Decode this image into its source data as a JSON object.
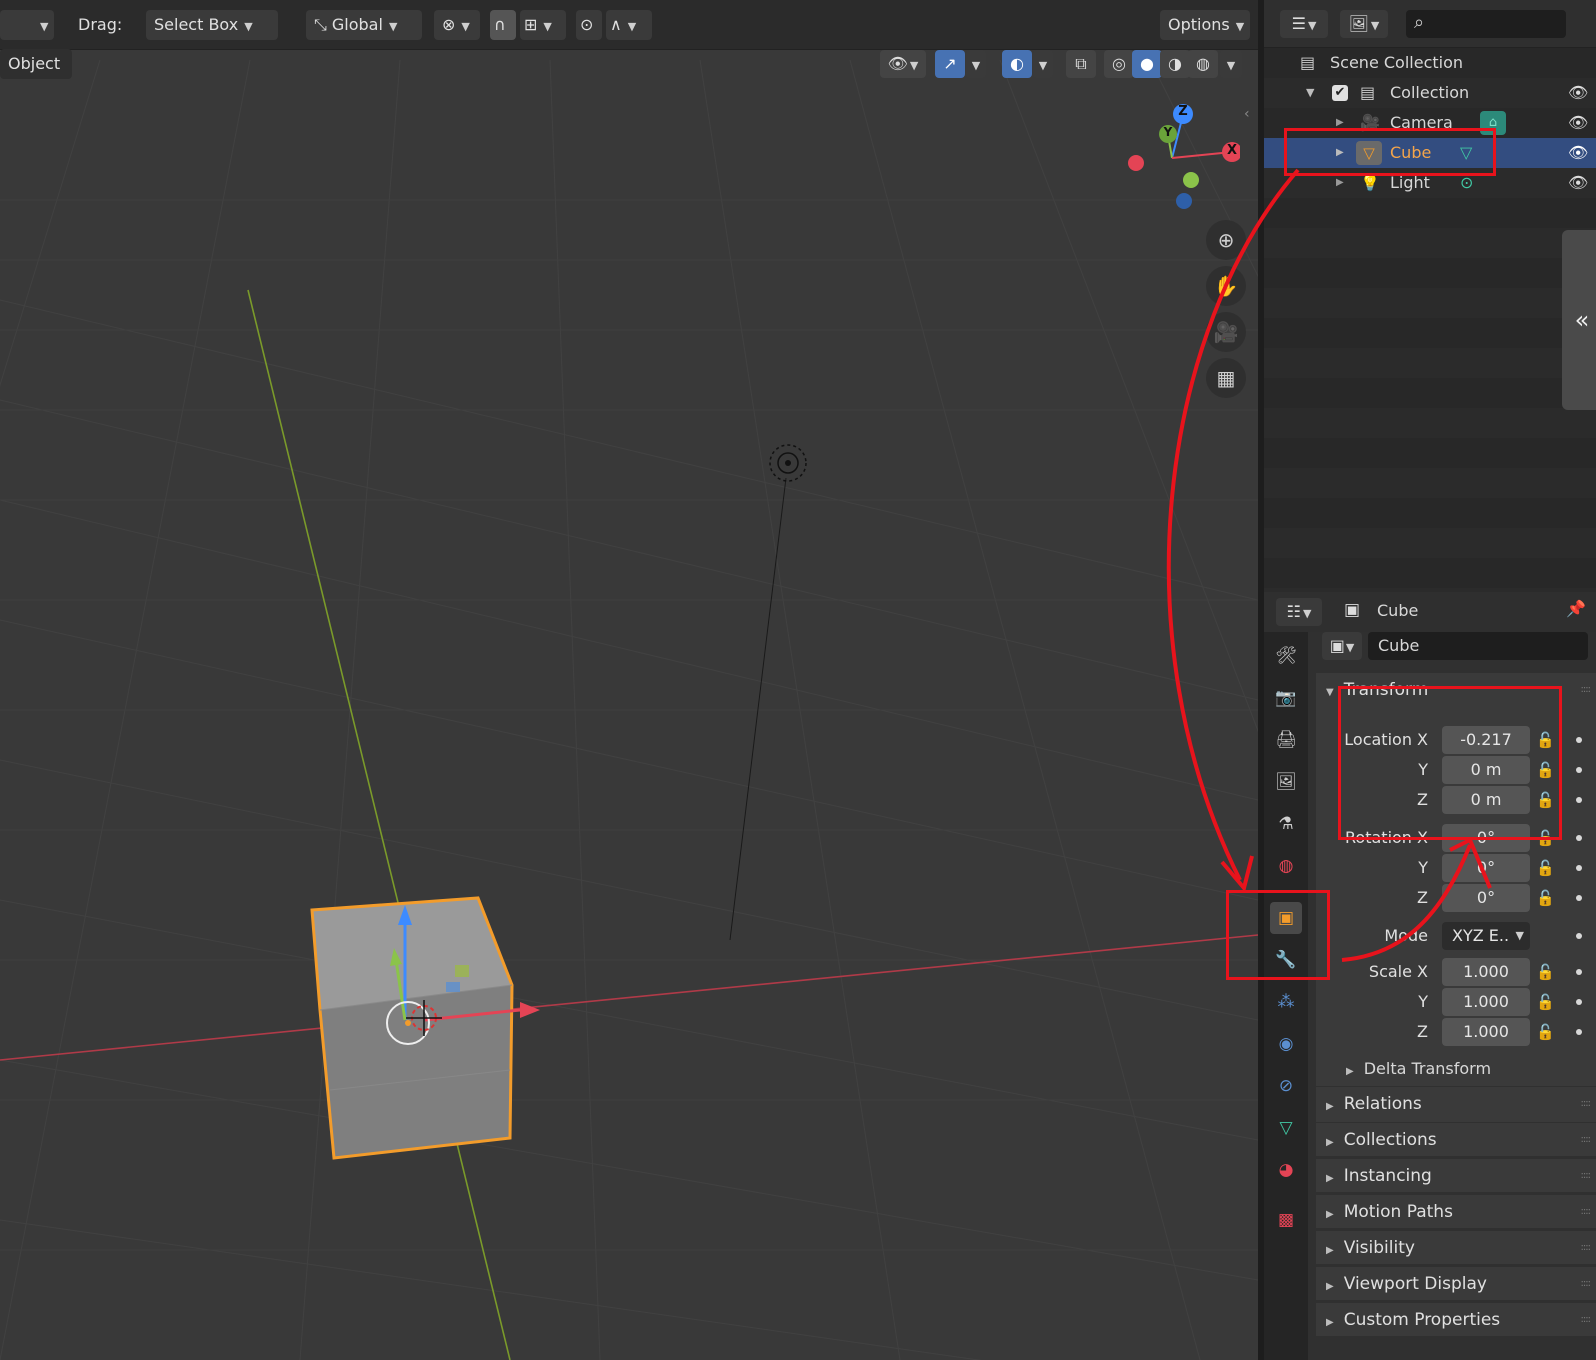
{
  "header": {
    "drag_label": "Drag:",
    "drag_value": "Select Box",
    "orientation_value": "Global",
    "options_label": "Options",
    "mode_label": "Object"
  },
  "gizmo": {
    "z": "Z",
    "y": "Y",
    "x": "X"
  },
  "outliner": {
    "scene_collection": "Scene Collection",
    "collection": "Collection",
    "items": [
      {
        "label": "Camera",
        "icon": "camera-icon"
      },
      {
        "label": "Cube",
        "icon": "mesh-icon"
      },
      {
        "label": "Light",
        "icon": "light-icon"
      }
    ]
  },
  "properties": {
    "object_name_header": "Cube",
    "object_name_field": "Cube",
    "transform_panel": "Transform",
    "location": {
      "label": "Location X",
      "x": "-0.217",
      "y_label": "Y",
      "y": "0 m",
      "z_label": "Z",
      "z": "0 m"
    },
    "rotation": {
      "label": "Rotation X",
      "x": "0°",
      "y_label": "Y",
      "y": "0°",
      "z_label": "Z",
      "z": "0°"
    },
    "mode": {
      "label": "Mode",
      "value": "XYZ E.."
    },
    "scale": {
      "label": "Scale X",
      "x": "1.000",
      "y_label": "Y",
      "y": "1.000",
      "z_label": "Z",
      "z": "1.000"
    },
    "delta_transform": "Delta Transform",
    "panels": [
      "Relations",
      "Collections",
      "Instancing",
      "Motion Paths",
      "Visibility",
      "Viewport Display",
      "Custom Properties"
    ]
  },
  "colors": {
    "selection_orange": "#f39c2b",
    "annotation_red": "#e8131c",
    "active_blue": "#334d80",
    "axis_x": "#e44455",
    "axis_y": "#8bc34a",
    "axis_z": "#3d8bff"
  }
}
